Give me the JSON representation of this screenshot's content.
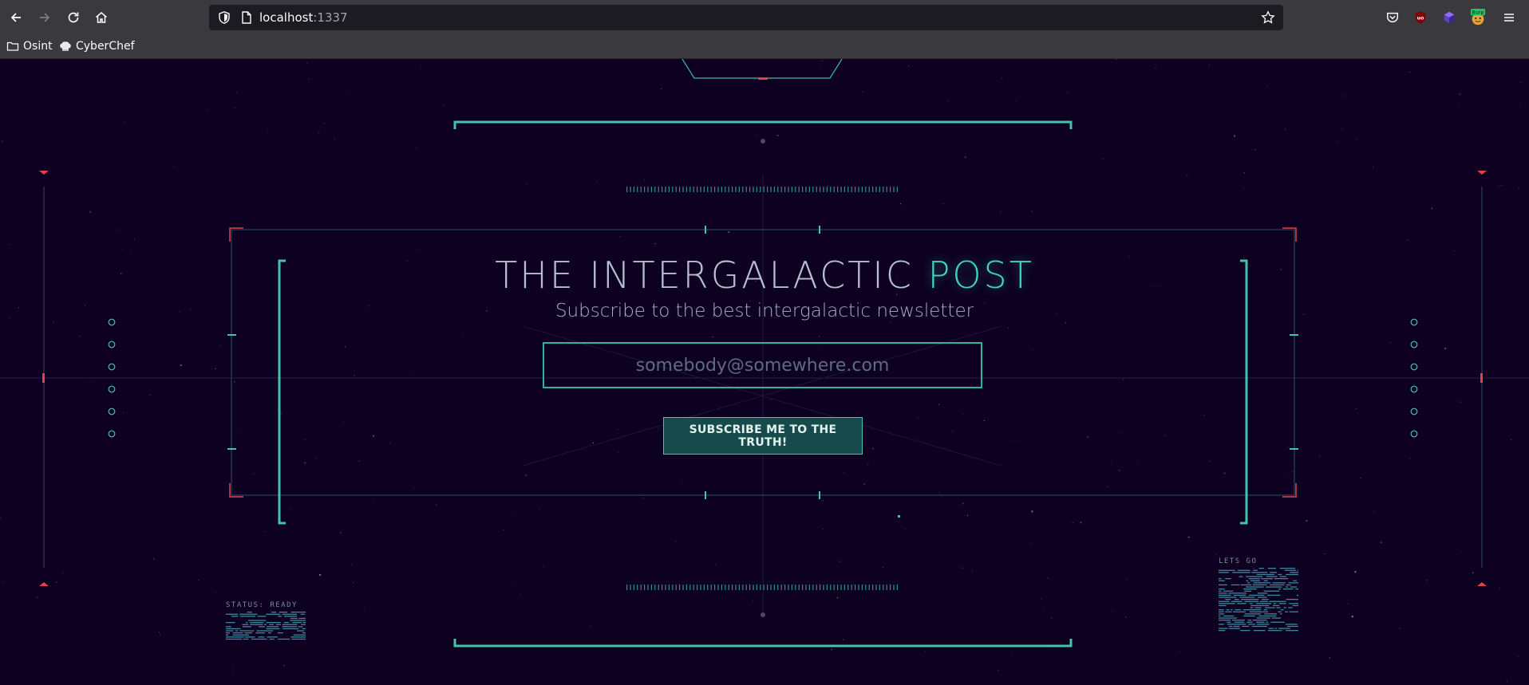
{
  "browser": {
    "url_host": "localhost",
    "url_port": ":1337",
    "bookmarks": [
      {
        "label": "Osint",
        "icon": "folder-icon"
      },
      {
        "label": "CyberChef",
        "icon": "chef-hat-icon"
      }
    ],
    "extensions": [
      {
        "name": "pocket-icon"
      },
      {
        "name": "ublock-icon",
        "badge": "uo"
      },
      {
        "name": "extension-cube-icon"
      },
      {
        "name": "burp-icon",
        "badge": "Burp"
      }
    ]
  },
  "page": {
    "title_main": "THE INTERGALACTIC ",
    "title_accent": "POST",
    "subtitle": "Subscribe to the best intergalactic newsletter",
    "email_placeholder": "somebody@somewhere.com",
    "subscribe_label": "SUBSCRIBE ME TO THE TRUTH!",
    "status_left": "STATUS: READY",
    "status_right": "LETS GO"
  },
  "colors": {
    "background": "#0d0020",
    "accent": "#3fd6bf",
    "frame": "#46c2ad",
    "warning": "#e0404e"
  }
}
